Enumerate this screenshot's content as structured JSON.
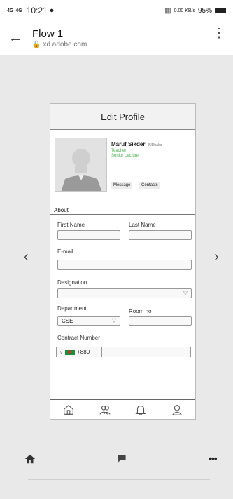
{
  "status_bar": {
    "signal1": "4G",
    "signal2": "4G",
    "time": "10:21",
    "net_speed": "0.00 KB/s",
    "battery": "95%"
  },
  "app_bar": {
    "title": "Flow 1",
    "url": "xd.adobe.com"
  },
  "prototype": {
    "header_title": "Edit Profile",
    "profile": {
      "name": "Maruf Sikder",
      "location": "IUDhaka",
      "role": "Teacher",
      "rank": "Senior Lecturer",
      "message_label": "Message",
      "contacts_label": "Contacts"
    },
    "about_label": "About",
    "form": {
      "first_name_label": "First Name",
      "last_name_label": "Last Name",
      "email_label": "E-mail",
      "designation_label": "Designation",
      "department_label": "Department",
      "department_value": "CSE",
      "room_label": "Room no",
      "contract_label": "Contract Number",
      "country_code": "+880"
    }
  },
  "colors": {
    "accent_green": "#4caf50",
    "flag_green": "#1a8f3b",
    "flag_red": "#d12b2b"
  },
  "icons": {
    "tabbar": [
      "home-icon",
      "group-icon",
      "bell-icon",
      "user-icon"
    ],
    "bottom_nav": [
      "home-icon",
      "comment-icon",
      "more-icon"
    ]
  }
}
